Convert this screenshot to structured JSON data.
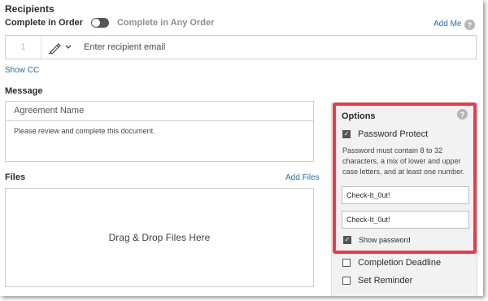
{
  "recipients": {
    "heading": "Recipients",
    "complete_in_order": "Complete in Order",
    "complete_in_any_order": "Complete in Any Order",
    "add_me": "Add Me",
    "help_icon": "?",
    "row_number": "1",
    "email_placeholder": "Enter recipient email",
    "show_cc": "Show CC"
  },
  "message": {
    "heading": "Message",
    "agreement_name_placeholder": "Agreement Name",
    "body": "Please review and complete this document."
  },
  "files": {
    "heading": "Files",
    "add_files": "Add Files",
    "drop_text": "Drag & Drop Files Here"
  },
  "options": {
    "title": "Options",
    "help_icon": "?",
    "password_protect": "Password Protect",
    "password_rule": "Password must contain 8 to 32 characters, a mix of lower and upper case letters, and at least one number.",
    "password_value": "Check-It_0ut!",
    "confirm_value": "Check-It_0ut!",
    "show_password": "Show password",
    "completion_deadline": "Completion Deadline",
    "set_reminder": "Set Reminder"
  },
  "colors": {
    "link": "#1f6fb6",
    "highlight": "#e2414a",
    "panel_bg": "#f2f2f2"
  }
}
